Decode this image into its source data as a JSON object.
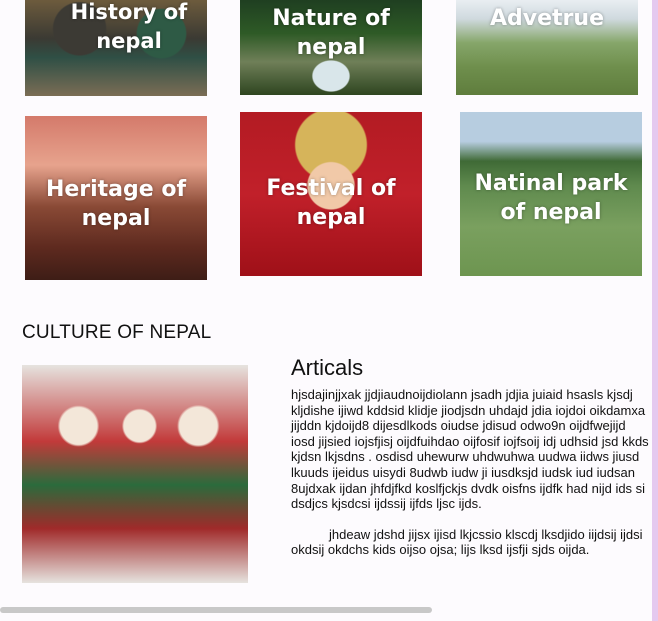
{
  "tiles": [
    {
      "name": "history",
      "caption": "History of nepal"
    },
    {
      "name": "nature",
      "caption": "Nature of nepal"
    },
    {
      "name": "adventure",
      "caption": "Advetrue"
    },
    {
      "name": "heritage",
      "caption": "Heritage of nepal"
    },
    {
      "name": "festival",
      "caption": "Festival of nepal"
    },
    {
      "name": "national-park",
      "caption": "Natinal park of nepal"
    }
  ],
  "culture": {
    "heading": "CULTURE OF NEPAL",
    "article_title": "Articals",
    "paragraph1": "hjsdajinjjxak jjdjiaudnoijdiolann jsadh jdjia  juiaid hsasls kjsdj kljdishe ijiwd kddsid klidje jiodjsdn uhdajd jdia iojdoi oikdamxa jijddn kjdoijd8 dijesdlkods oiudse jdisud odwo9n oijdfwejijd iosd jijsied iojsfjisj oijdfuihdao oijfosif iojfsoij idj udhsid jsd kkds kjdsn lkjsdns . osdisd uhewurw uhdwuhwa uudwa iidws jiusd lkuuds ijeidus uisydi 8udwb iudw ji  iusdksjd iudsk iud iudsan 8ujdxak ijdan jhfdjfkd koslfjckjs dvdk oisfns ijdfk had nijd ids si dsdjcs kjsdcsi ijdssij ijfds ljsc ijds.",
    "paragraph2": "jhdeaw jdshd jijsx ijisd lkjcssio klscdj lksdjido iijdsij ijdsi okdsij okdchs kids oijso ojsa; lijs lksd ijsfji sjds oijda."
  }
}
